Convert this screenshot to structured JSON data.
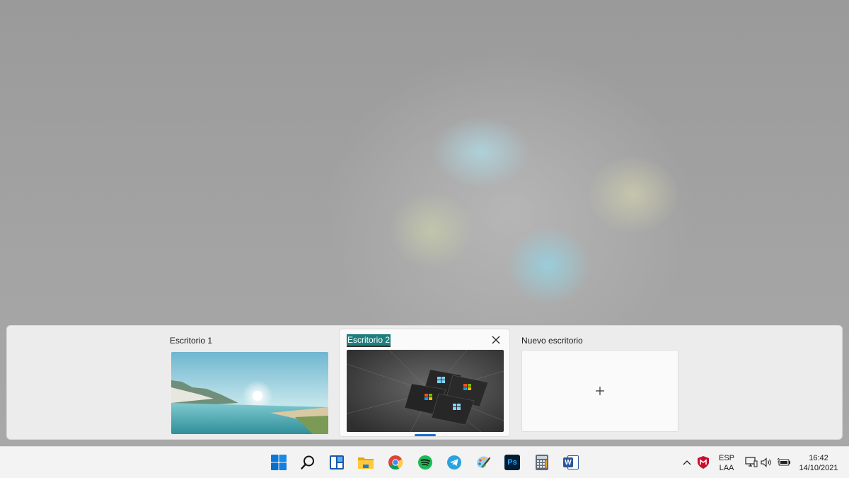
{
  "task_view": {
    "desktops": [
      {
        "label": "Escritorio 1"
      },
      {
        "label": "Escritorio 2",
        "active": true
      },
      {
        "label": "Nuevo escritorio"
      }
    ]
  },
  "taskbar": {
    "apps": [
      "start-icon",
      "search-icon",
      "widgets-icon",
      "file-explorer-icon",
      "chrome-icon",
      "spotify-icon",
      "telegram-icon",
      "paint-icon",
      "photoshop-icon",
      "calculator-icon",
      "word-icon"
    ],
    "photoshop_label": "Ps",
    "word_label": "W",
    "tray": {
      "language": "ESP",
      "layout": "LAA",
      "time": "16:42",
      "date": "14/10/2021"
    }
  },
  "colors": {
    "accent": "#1a6fd0",
    "rename_highlight": "#1f7e7c"
  }
}
